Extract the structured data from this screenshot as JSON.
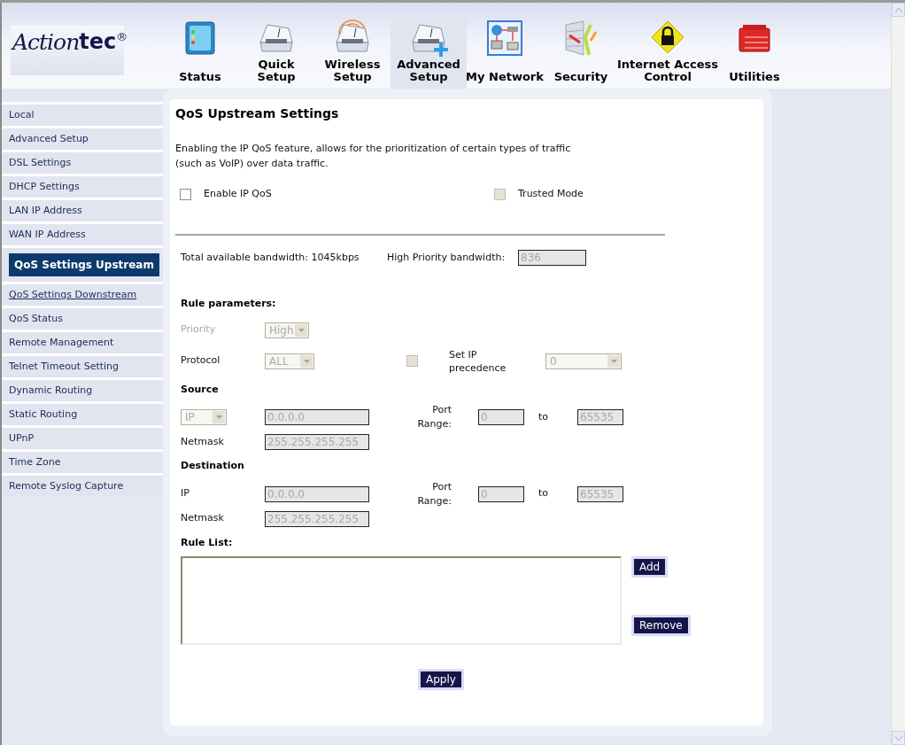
{
  "logo": {
    "parts": [
      "Action",
      "tec"
    ],
    "mark": "®"
  },
  "nav": [
    {
      "lines": [
        "Status"
      ],
      "kind": "status",
      "selected": false
    },
    {
      "lines": [
        "Quick",
        "Setup"
      ],
      "kind": "quick",
      "selected": false
    },
    {
      "lines": [
        "Wireless",
        "Setup"
      ],
      "kind": "wireless",
      "selected": false
    },
    {
      "lines": [
        "Advanced",
        "Setup"
      ],
      "kind": "advanced",
      "selected": true
    },
    {
      "lines": [
        "My Network"
      ],
      "kind": "network",
      "selected": false
    },
    {
      "lines": [
        "Security"
      ],
      "kind": "security",
      "selected": false
    },
    {
      "lines": [
        "Internet Access",
        "Control"
      ],
      "kind": "access",
      "selected": false
    },
    {
      "lines": [
        "Utilities"
      ],
      "kind": "utilities",
      "selected": false
    }
  ],
  "sidebar": {
    "items": [
      {
        "label": "Local",
        "selected": false,
        "hovered": false
      },
      {
        "label": "Advanced Setup",
        "selected": false,
        "hovered": false
      },
      {
        "label": "DSL Settings",
        "selected": false,
        "hovered": false
      },
      {
        "label": "DHCP Settings",
        "selected": false,
        "hovered": false
      },
      {
        "label": "LAN IP Address",
        "selected": false,
        "hovered": false
      },
      {
        "label": "WAN IP Address",
        "selected": false,
        "hovered": false
      },
      {
        "label": "QoS Settings Upstream",
        "selected": true,
        "hovered": false
      },
      {
        "label": "QoS Settings Downstream",
        "selected": false,
        "hovered": true
      },
      {
        "label": "QoS Status",
        "selected": false,
        "hovered": false
      },
      {
        "label": "Remote Management",
        "selected": false,
        "hovered": false
      },
      {
        "label": "Telnet Timeout Setting",
        "selected": false,
        "hovered": false
      },
      {
        "label": "Dynamic Routing",
        "selected": false,
        "hovered": false
      },
      {
        "label": "Static Routing",
        "selected": false,
        "hovered": false
      },
      {
        "label": "UPnP",
        "selected": false,
        "hovered": false
      },
      {
        "label": "Time Zone",
        "selected": false,
        "hovered": false
      },
      {
        "label": "Remote Syslog Capture",
        "selected": false,
        "hovered": false
      }
    ]
  },
  "form": {
    "title": "QoS Upstream Settings",
    "description": "Enabling the IP QoS feature, allows for the prioritization of certain types of traffic (such as VoIP) over data traffic.",
    "options": [
      {
        "label": "Enable IP QoS",
        "checked": false,
        "disabled": false
      },
      {
        "label": "Trusted Mode",
        "checked": false,
        "disabled": true
      }
    ],
    "bandwidth": {
      "total": "Total available bandwidth: 1045kbps",
      "high_label": "High Priority bandwidth:",
      "high_value": "836",
      "disabled": true
    },
    "rule_parameters": {
      "heading": "Rule parameters:",
      "priority": {
        "label": "Priority",
        "value": "High",
        "disabled": true,
        "dimmed": true
      },
      "protocol": {
        "label": "Protocol",
        "value": "ALL",
        "disabled": true,
        "dimmed": false
      },
      "precedence": {
        "label": "Set IP precedence",
        "checked": false,
        "disabled": true,
        "value": "0"
      }
    },
    "source": {
      "heading": "Source",
      "address_type": "IP",
      "address": "0.0.0.0",
      "port_label": "Port Range:",
      "port_from": "0",
      "to": "to",
      "port_to": "65535",
      "netmask_label": "Netmask",
      "netmask": "255.255.255.255",
      "disabled": true
    },
    "destination": {
      "heading": "Destination",
      "address_label": "IP",
      "address": "0.0.0.0",
      "port_label": "Port Range:",
      "port_from": "0",
      "to": "to",
      "port_to": "65535",
      "netmask_label": "Netmask",
      "netmask": "255.255.255.255",
      "disabled": true
    },
    "rule_list": {
      "heading": "Rule List:",
      "add": "Add",
      "remove": "Remove"
    },
    "apply": "Apply"
  }
}
